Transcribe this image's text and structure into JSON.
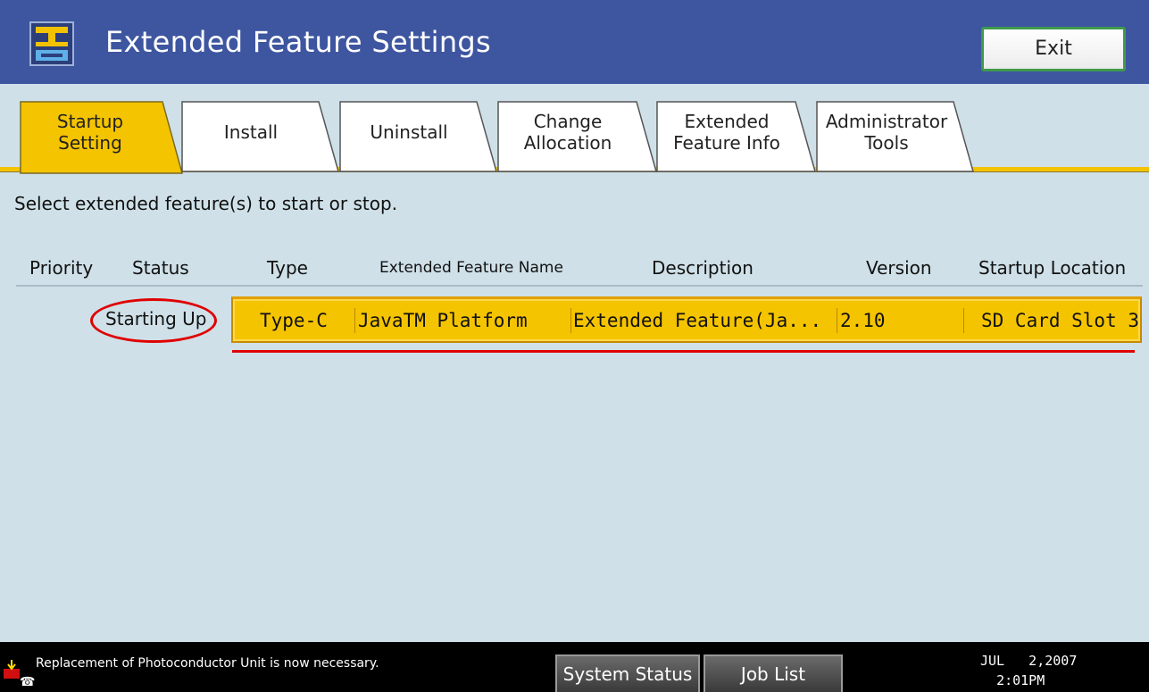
{
  "header": {
    "title": "Extended Feature Settings",
    "icon": "extended-feature-settings-icon",
    "exit_label": "Exit"
  },
  "tabs": [
    {
      "label": "Startup\nSetting",
      "active": true
    },
    {
      "label": "Install",
      "active": false
    },
    {
      "label": "Uninstall",
      "active": false
    },
    {
      "label": "Change\nAllocation",
      "active": false
    },
    {
      "label": "Extended\nFeature Info",
      "active": false
    },
    {
      "label": "Administrator\nTools",
      "active": false
    }
  ],
  "instruction": "Select extended feature(s) to start or stop.",
  "columns": {
    "priority": "Priority",
    "status": "Status",
    "type": "Type",
    "name": "Extended Feature Name",
    "description": "Description",
    "version": "Version",
    "location": "Startup Location"
  },
  "rows": [
    {
      "priority": "",
      "status": "Starting Up",
      "type": "Type-C",
      "name": "JavaTM Platform",
      "description": "Extended Feature(Ja...",
      "version": "2.10",
      "location": "SD Card Slot 3",
      "selected": true
    }
  ],
  "footer": {
    "message": "Replacement of Photoconductor Unit is now necessary.",
    "system_status_label": "System Status",
    "job_list_label": "Job List",
    "date": "JUL   2,2007",
    "time": "2:01PM"
  },
  "colors": {
    "title_bar": "#3e56a0",
    "active_tab": "#f5c400",
    "background": "#cfe0e8",
    "selected_row": "#f5c400",
    "annotation": "#e00000",
    "exit_border": "#3f9a4c"
  }
}
